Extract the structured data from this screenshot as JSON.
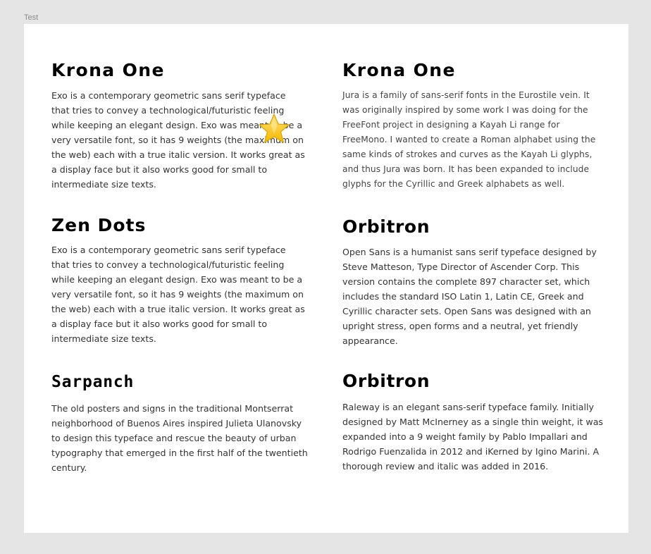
{
  "frame": {
    "label": "Test"
  },
  "cards": [
    {
      "title": "Krona One",
      "body": "Exo is a contemporary geometric sans serif typeface that tries to convey a technological/futuristic feeling while keeping an elegant design. Exo was meant to be a very versatile font, so it has 9 weights (the maximum on the web) each with a true italic version. It works great as a display face but it also works good for small to intermediate size texts."
    },
    {
      "title": "Krona One",
      "body": "Jura is a family of sans-serif fonts in the Eurostile vein. It was originally inspired by some work I was doing for the FreeFont project in designing a Kayah Li range for FreeMono. I wanted to create a Roman alphabet using the same kinds of strokes and curves as the Kayah Li glyphs, and thus Jura was born. It has been expanded to include glyphs for the Cyrillic and Greek alphabets as well."
    },
    {
      "title": "Zen Dots",
      "body": "Exo is a contemporary geometric sans serif typeface that tries to convey a technological/futuristic feeling while keeping an elegant design. Exo was meant to be a very versatile font, so it has 9 weights (the maximum on the web) each with a true italic version. It works great as a display face but it also works good for small to intermediate size texts."
    },
    {
      "title": "Orbitron",
      "body": "Open Sans is a humanist sans serif typeface designed by Steve Matteson, Type Director of Ascender Corp. This version contains the complete 897 character set, which includes the standard ISO Latin 1, Latin CE, Greek and Cyrillic character sets. Open Sans was designed with an upright stress, open forms and a neutral, yet friendly appearance."
    },
    {
      "title": "Sarpanch",
      "body": "The old posters and signs in the traditional Montserrat neighborhood of Buenos Aires inspired Julieta Ulanovsky to design this typeface and rescue the beauty of urban typography that emerged in the first half of the twentieth century."
    },
    {
      "title": "Orbitron",
      "body": "Raleway is an elegant sans-serif typeface family. Initially designed by Matt McInerney as a single thin weight, it was expanded into a 9 weight family by Pablo Impallari and Rodrigo Fuenzalida in 2012 and iKerned by Igino Marini. A thorough review and italic was added in 2016."
    }
  ],
  "overlay": {
    "icon": "star-icon",
    "color": "#f7c531"
  }
}
